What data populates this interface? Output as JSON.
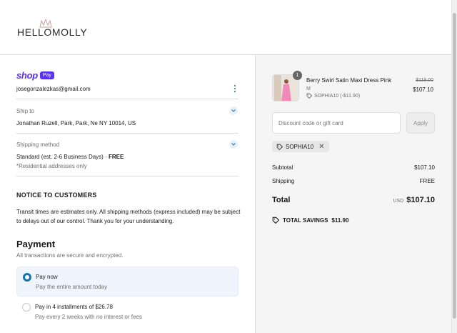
{
  "store": {
    "name": "HELLOMOLLY"
  },
  "contact": {
    "shop_word": "shop",
    "pay_badge": "Pay",
    "email": "josegonzalezkas@gmail.com"
  },
  "ship_to": {
    "label": "Ship to",
    "value": "Jonathan Ruzell, Park, Park, Ne NY 10014, US"
  },
  "shipping_method": {
    "label": "Shipping method",
    "value": "Standard (est. 2-6 Business Days) · ",
    "price": "FREE",
    "note": "*Residential addresses only"
  },
  "notice": {
    "title": "NOTICE TO CUSTOMERS",
    "body": "Transit times are estimates only. All shipping methods (express included) may be subject to delays out of our control. Thank you for your understanding."
  },
  "payment": {
    "title": "Payment",
    "subtitle": "All transactions are secure and encrypted.",
    "options": [
      {
        "title": "Pay now",
        "subtitle": "Pay the entire amount today",
        "selected": true
      },
      {
        "title": "Pay in 4 installments of $26.78",
        "subtitle": "Pay every 2 weeks with no interest or fees",
        "selected": false
      }
    ]
  },
  "cart": {
    "item": {
      "quantity": "1",
      "name": "Berry Swirl Satin Maxi Dress Pink",
      "variant": "M",
      "discount": "SOPHIA10 (-$11.90)",
      "original_price": "$119.00",
      "price": "$107.10"
    },
    "discount_placeholder": "Discount code or gift card",
    "apply_label": "Apply",
    "applied_code": "SOPHIA10",
    "subtotal_label": "Subtotal",
    "subtotal": "$107.10",
    "shipping_label": "Shipping",
    "shipping": "FREE",
    "total_label": "Total",
    "currency": "USD",
    "total": "$107.10",
    "savings_label": "TOTAL SAVINGS",
    "savings": "$11.90"
  },
  "colors": {
    "accent": "#1773b0",
    "shop_purple": "#5a31f4",
    "summary_bg": "#f5f5f5",
    "selected_bg": "#f0f5fd"
  }
}
